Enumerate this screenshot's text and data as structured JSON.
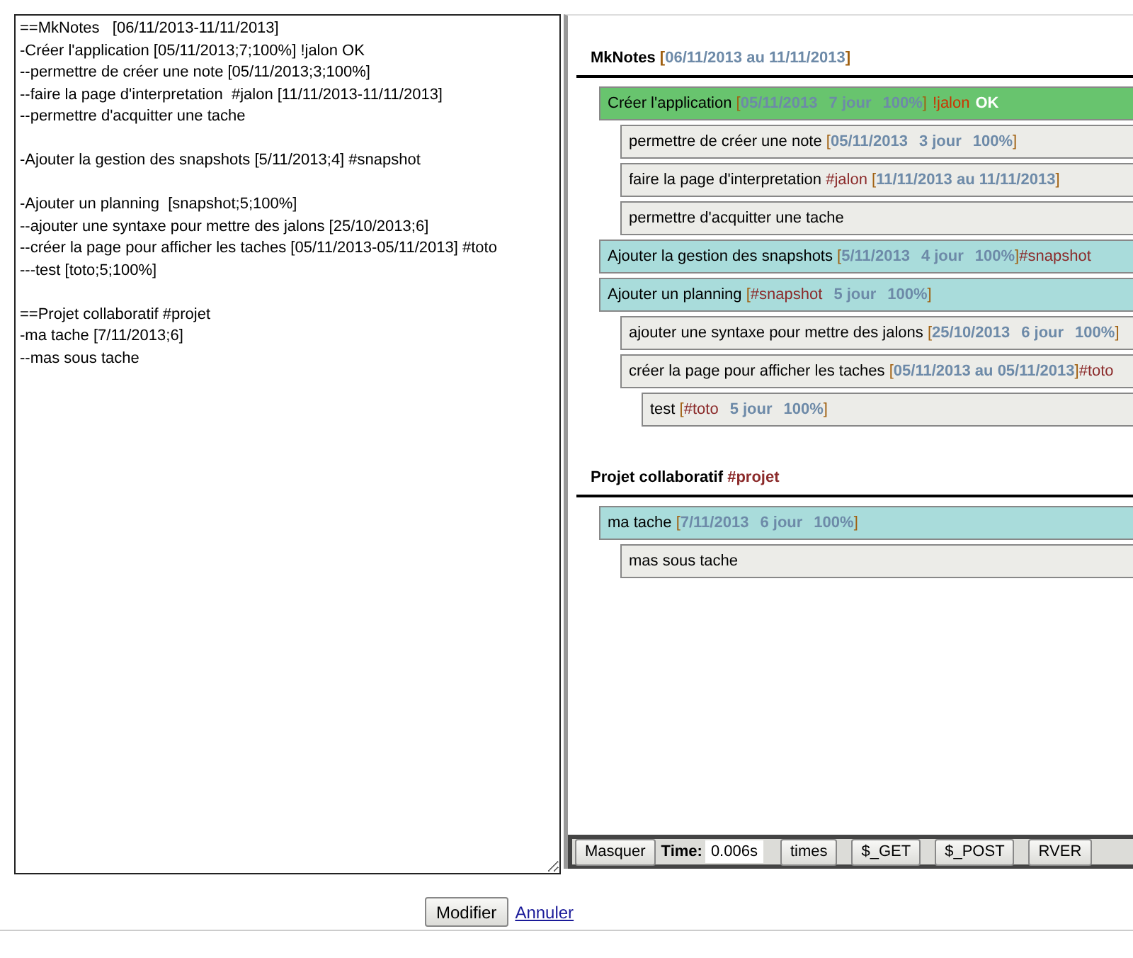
{
  "editor": {
    "value": "==MkNotes   [06/11/2013-11/11/2013]\n-Créer l'application [05/11/2013;7;100%] !jalon OK\n--permettre de créer une note [05/11/2013;3;100%]\n--faire la page d'interpretation  #jalon [11/11/2013-11/11/2013]\n--permettre d'acquitter une tache\n\n-Ajouter la gestion des snapshots [5/11/2013;4] #snapshot\n\n-Ajouter un planning  [snapshot;5;100%]\n--ajouter une syntaxe pour mettre des jalons [25/10/2013;6]\n--créer la page pour afficher les taches [05/11/2013-05/11/2013] #toto\n---test [toto;5;100%]\n\n==Projet collaboratif #projet\n-ma tache [7/11/2013;6]\n--mas sous tache"
  },
  "sections": [
    {
      "title": [
        {
          "kind": "text",
          "text": "MkNotes "
        },
        {
          "kind": "bracket",
          "text": "["
        },
        {
          "kind": "meta",
          "text": "06/11/2013 au 11/11/2013"
        },
        {
          "kind": "bracket",
          "text": "]"
        }
      ],
      "tasks": [
        {
          "kind": "milestone",
          "parts": [
            {
              "kind": "text",
              "text": "Créer l'application "
            },
            {
              "kind": "bracket",
              "text": "["
            },
            {
              "kind": "meta",
              "text": "05/11/2013"
            },
            {
              "kind": "meta",
              "text": "7 jour"
            },
            {
              "kind": "meta",
              "text": "100%"
            },
            {
              "kind": "bracket",
              "text": "]"
            },
            {
              "kind": "jalon",
              "text": "!jalon"
            },
            {
              "kind": "ok",
              "text": "OK"
            }
          ],
          "children": [
            {
              "kind": "subtask",
              "parts": [
                {
                  "kind": "text",
                  "text": "permettre de créer une note "
                },
                {
                  "kind": "bracket",
                  "text": "["
                },
                {
                  "kind": "meta",
                  "text": "05/11/2013"
                },
                {
                  "kind": "meta",
                  "text": "3 jour"
                },
                {
                  "kind": "meta",
                  "text": "100%"
                },
                {
                  "kind": "bracket",
                  "text": "]"
                }
              ]
            },
            {
              "kind": "subtask",
              "parts": [
                {
                  "kind": "text",
                  "text": "faire la page d'interpretation "
                },
                {
                  "kind": "tag",
                  "text": "#jalon"
                },
                {
                  "kind": "bracket",
                  "text": " ["
                },
                {
                  "kind": "meta",
                  "text": "11/11/2013 au 11/11/2013"
                },
                {
                  "kind": "bracket",
                  "text": "]"
                }
              ]
            },
            {
              "kind": "subtask",
              "parts": [
                {
                  "kind": "text",
                  "text": "permettre d'acquitter une tache"
                }
              ]
            }
          ]
        },
        {
          "kind": "task",
          "parts": [
            {
              "kind": "text",
              "text": "Ajouter la gestion des snapshots "
            },
            {
              "kind": "bracket",
              "text": "["
            },
            {
              "kind": "meta",
              "text": "5/11/2013"
            },
            {
              "kind": "meta",
              "text": "4 jour"
            },
            {
              "kind": "meta",
              "text": "100%"
            },
            {
              "kind": "bracket",
              "text": "]"
            },
            {
              "kind": "tag",
              "text": "#snapshot"
            }
          ]
        },
        {
          "kind": "task",
          "parts": [
            {
              "kind": "text",
              "text": "Ajouter un planning "
            },
            {
              "kind": "bracket",
              "text": "["
            },
            {
              "kind": "tag",
              "text": "#snapshot"
            },
            {
              "kind": "meta",
              "text": "5 jour"
            },
            {
              "kind": "meta",
              "text": "100%"
            },
            {
              "kind": "bracket",
              "text": "]"
            }
          ],
          "children": [
            {
              "kind": "subtask",
              "parts": [
                {
                  "kind": "text",
                  "text": "ajouter une syntaxe pour mettre des jalons "
                },
                {
                  "kind": "bracket",
                  "text": "["
                },
                {
                  "kind": "meta",
                  "text": "25/10/2013"
                },
                {
                  "kind": "meta",
                  "text": "6 jour"
                },
                {
                  "kind": "meta",
                  "text": "100%"
                },
                {
                  "kind": "bracket",
                  "text": "]"
                }
              ]
            },
            {
              "kind": "subtask",
              "parts": [
                {
                  "kind": "text",
                  "text": "créer la page pour afficher les taches "
                },
                {
                  "kind": "bracket",
                  "text": "["
                },
                {
                  "kind": "meta",
                  "text": "05/11/2013 au 05/11/2013"
                },
                {
                  "kind": "bracket",
                  "text": "]"
                },
                {
                  "kind": "tag",
                  "text": "#toto"
                }
              ],
              "children": [
                {
                  "kind": "subtask",
                  "parts": [
                    {
                      "kind": "text",
                      "text": "test "
                    },
                    {
                      "kind": "bracket",
                      "text": "["
                    },
                    {
                      "kind": "tag",
                      "text": "#toto"
                    },
                    {
                      "kind": "meta",
                      "text": "5 jour"
                    },
                    {
                      "kind": "meta",
                      "text": "100%"
                    },
                    {
                      "kind": "bracket",
                      "text": "]"
                    }
                  ]
                }
              ]
            }
          ]
        }
      ]
    },
    {
      "title": [
        {
          "kind": "text",
          "text": "Projet collaboratif "
        },
        {
          "kind": "tag",
          "text": "#projet"
        }
      ],
      "tasks": [
        {
          "kind": "task",
          "parts": [
            {
              "kind": "text",
              "text": "ma tache "
            },
            {
              "kind": "bracket",
              "text": "["
            },
            {
              "kind": "meta",
              "text": "7/11/2013"
            },
            {
              "kind": "meta",
              "text": "6 jour"
            },
            {
              "kind": "meta",
              "text": "100%"
            },
            {
              "kind": "bracket",
              "text": "]"
            }
          ],
          "children": [
            {
              "kind": "subtask",
              "parts": [
                {
                  "kind": "text",
                  "text": "mas sous tache"
                }
              ]
            }
          ]
        }
      ]
    }
  ],
  "debug_bar": {
    "hide_button": "Masquer",
    "time_label": "Time:",
    "time_value": "0.006s",
    "buttons": [
      "times",
      "$_GET",
      "$_POST",
      "RVER"
    ]
  },
  "form": {
    "submit": "Modifier",
    "cancel": "Annuler"
  }
}
